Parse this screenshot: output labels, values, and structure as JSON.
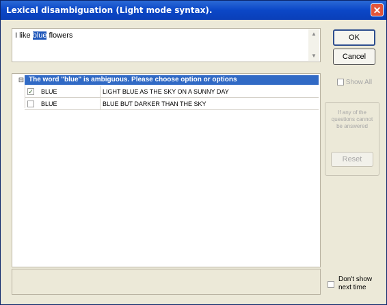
{
  "window": {
    "title": "Lexical disambiguation (Light mode syntax)."
  },
  "sentence": {
    "before": "I like ",
    "highlight": "blue",
    "after": " flowers"
  },
  "buttons": {
    "ok": "OK",
    "cancel": "Cancel",
    "show_all": "Show All",
    "reset": "Reset"
  },
  "ambiguity": {
    "header": "The word \"blue\" is ambiguous. Please choose option or options",
    "options": [
      {
        "word": "BLUE",
        "description": "LIGHT BLUE AS THE SKY ON A SUNNY DAY",
        "checked": true
      },
      {
        "word": "BLUE",
        "description": "BLUE BUT DARKER THAN THE SKY",
        "checked": false
      }
    ]
  },
  "unanswered_note": "If any of the questions cannot be answered",
  "dont_show": "Don't show next time"
}
